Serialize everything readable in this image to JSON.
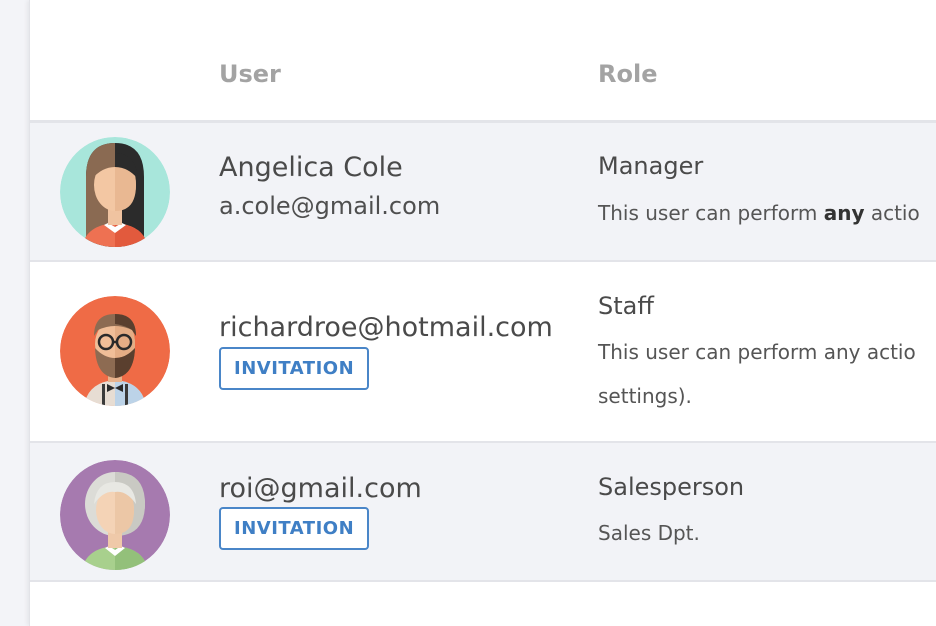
{
  "table": {
    "headers": {
      "user": "User",
      "role": "Role"
    }
  },
  "users": [
    {
      "name": "Angelica Cole",
      "email": "a.cole@gmail.com",
      "role": "Manager",
      "role_desc_before": "This user can perform ",
      "role_desc_bold": "any",
      "role_desc_after": " actio",
      "avatar_bg": "#a8e6db"
    },
    {
      "email": "richardroe@hotmail.com",
      "badge": "INVITATION",
      "role": "Staff",
      "role_desc_line1": "This user can perform any actio",
      "role_desc_line2": "settings).",
      "avatar_bg": "#ef6b46"
    },
    {
      "email": "roi@gmail.com",
      "badge": "INVITATION",
      "role": "Salesperson",
      "role_desc": "Sales Dpt.",
      "avatar_bg": "#a67aaf"
    }
  ],
  "colors": {
    "badge_border": "#4a86c8",
    "header_text": "#a3a3a3",
    "row_shade": "#f2f3f7"
  }
}
